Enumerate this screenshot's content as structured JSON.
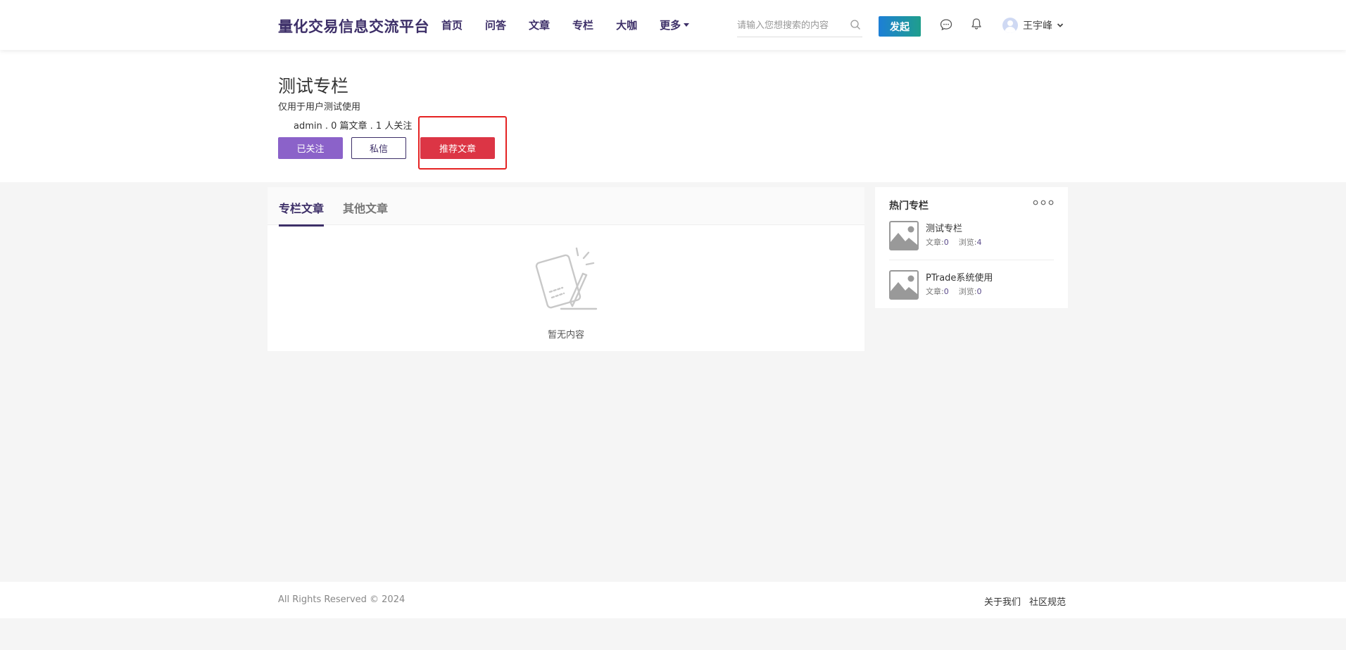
{
  "header": {
    "logo": "量化交易信息交流平台",
    "nav": [
      "首页",
      "问答",
      "文章",
      "专栏",
      "大咖"
    ],
    "nav_more": "更多",
    "search_placeholder": "请输入您想搜索的内容",
    "post_button": "发起",
    "user_name": "王宇峰"
  },
  "column": {
    "title": "测试专栏",
    "description": "仅用于用户测试使用",
    "meta": "admin . 0 篇文章 . 1 人关注",
    "followed_button": "已关注",
    "message_button": "私信",
    "recommend_button": "推荐文章"
  },
  "main": {
    "tabs": [
      "专栏文章",
      "其他文章"
    ],
    "empty_text": "暂无内容"
  },
  "sidebar": {
    "title": "热门专栏",
    "items": [
      {
        "name": "测试专栏",
        "articles_label": "文章:",
        "articles": "0",
        "views_label": "浏览:",
        "views": "4"
      },
      {
        "name": "PTrade系统使用",
        "articles_label": "文章:",
        "articles": "0",
        "views_label": "浏览:",
        "views": "0"
      }
    ]
  },
  "footer": {
    "copyright": "All Rights Reserved © 2024",
    "links": [
      "关于我们",
      "社区规范"
    ]
  },
  "colors": {
    "brand": "#3d2f68",
    "followed": "#8b62c9",
    "recommend": "#dc3545",
    "highlight": "#e52222"
  }
}
